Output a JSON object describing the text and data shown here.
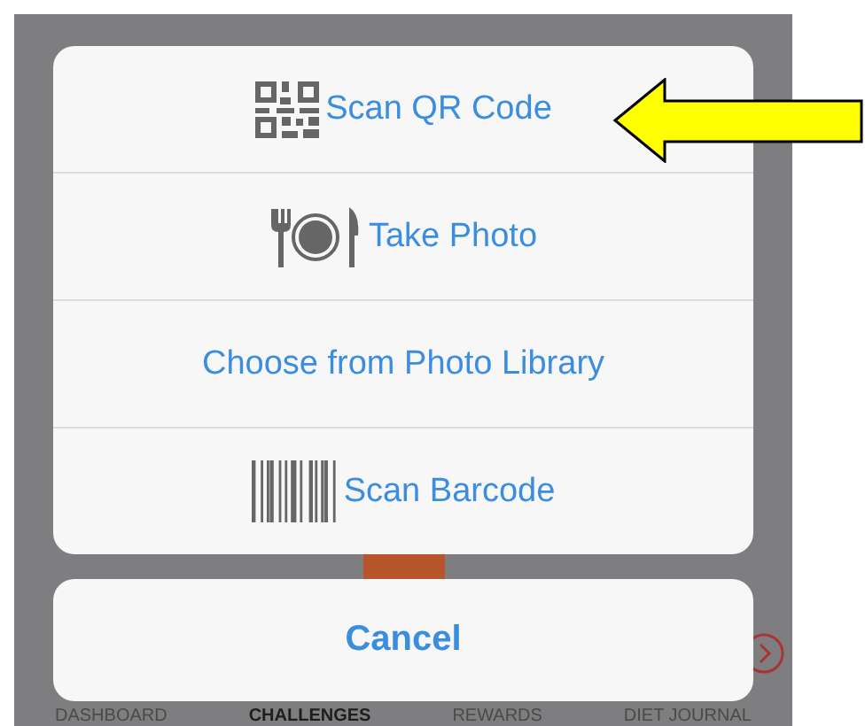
{
  "action_sheet": {
    "options": [
      {
        "kind": "qr",
        "label": "Scan QR Code",
        "pointed_at": true
      },
      {
        "kind": "meal",
        "label": "Take Photo",
        "pointed_at": false
      },
      {
        "kind": "plain",
        "label": "Choose from Photo Library",
        "pointed_at": false
      },
      {
        "kind": "barcode",
        "label": "Scan Barcode",
        "pointed_at": false
      }
    ],
    "cancel": "Cancel"
  },
  "tab_bar": [
    {
      "label": "DASHBOARD",
      "selected": false
    },
    {
      "label": "CHALLENGES",
      "selected": true
    },
    {
      "label": "REWARDS",
      "selected": false
    },
    {
      "label": "DIET JOURNAL",
      "selected": false
    }
  ]
}
